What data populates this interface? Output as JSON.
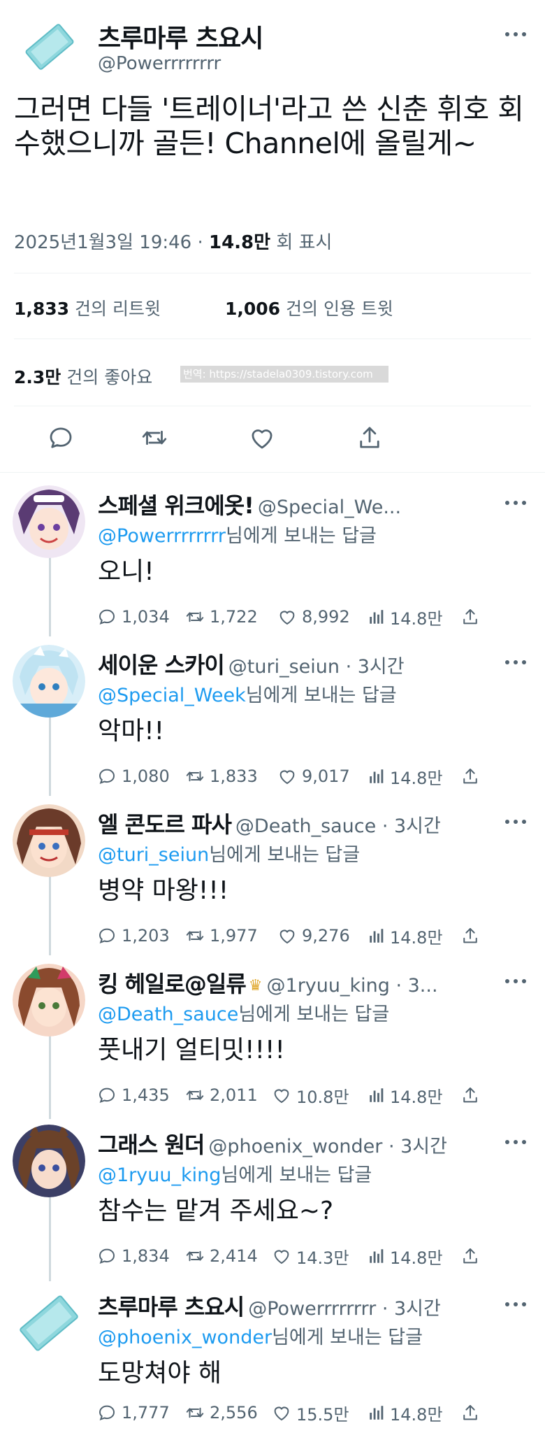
{
  "main": {
    "name": "츠루마루 츠요시",
    "handle": "@Powerrrrrrrr",
    "text": "그러면 다들 '트레이너'라고 쓴 신춘 휘호 회수했으니까 골든! Channel에 올릴게~",
    "datetime": "2025년1월3일 19:46 · ",
    "views_value": "14.8만",
    "views_label": " 회 표시",
    "retweets_value": "1,833",
    "retweets_label": " 건의 리트윗",
    "quotes_value": "1,006",
    "quotes_label": " 건의 인용 트윗",
    "likes_value": "2.3만",
    "likes_label": " 건의 좋아요",
    "watermark": "번역: https://stadela0309.tistory.com"
  },
  "replies": [
    {
      "name": "스페셜 위크에옷!",
      "handle": "@Special_We...",
      "time": "",
      "mention": "@Powerrrrrrrr",
      "replying_suffix": "님에게 보내는 답글",
      "text": "오니!",
      "replies": "1,034",
      "retweets": "1,722",
      "likes": "8,992",
      "views": "14.8만",
      "avatar_color": "#7d5ba6"
    },
    {
      "name": "세이운 스카이",
      "handle": "@turi_seiun · 3시간",
      "time": "",
      "mention": "@Special_Week",
      "replying_suffix": "님에게 보내는 답글",
      "text": "악마!!",
      "replies": "1,080",
      "retweets": "1,833",
      "likes": "9,017",
      "views": "14.8만",
      "avatar_color": "#5fa9d9"
    },
    {
      "name": "엘 콘도르 파사",
      "handle": "@Death_sauce · 3시간",
      "time": "",
      "mention": "@turi_seiun",
      "replying_suffix": "님에게 보내는 답글",
      "text": "병약 마왕!!!",
      "replies": "1,203",
      "retweets": "1,977",
      "likes": "9,276",
      "views": "14.8만",
      "avatar_color": "#6b3b2a"
    },
    {
      "name": "킹 헤일로@일류",
      "handle": "@1ryuu_king · 3...",
      "time": "",
      "mention": "@Death_sauce",
      "replying_suffix": "님에게 보내는 답글",
      "text": "풋내기 얼티밋!!!!",
      "replies": "1,435",
      "retweets": "2,011",
      "likes": "10.8만",
      "views": "14.8만",
      "avatar_color": "#8a4a2e"
    },
    {
      "name": "그래스 원더",
      "handle": "@phoenix_wonder · 3시간",
      "time": "",
      "mention": "@1ryuu_king",
      "replying_suffix": "님에게 보내는 답글",
      "text": "참수는 맡겨 주세요~?",
      "replies": "1,834",
      "retweets": "2,414",
      "likes": "14.3만",
      "views": "14.8만",
      "avatar_color": "#3c3f66"
    },
    {
      "name": "츠루마루 츠요시",
      "handle": "@Powerrrrrrrr · 3시간",
      "time": "",
      "mention": "@phoenix_wonder",
      "replying_suffix": "님에게 보내는 답글",
      "text": "도망쳐야 해",
      "replies": "1,777",
      "retweets": "2,556",
      "likes": "15.5만",
      "views": "14.8만",
      "avatar_color": "#8fd6da"
    }
  ],
  "colors": {
    "link": "#1d9bf0",
    "secondary": "#536471",
    "text": "#0f1419"
  }
}
